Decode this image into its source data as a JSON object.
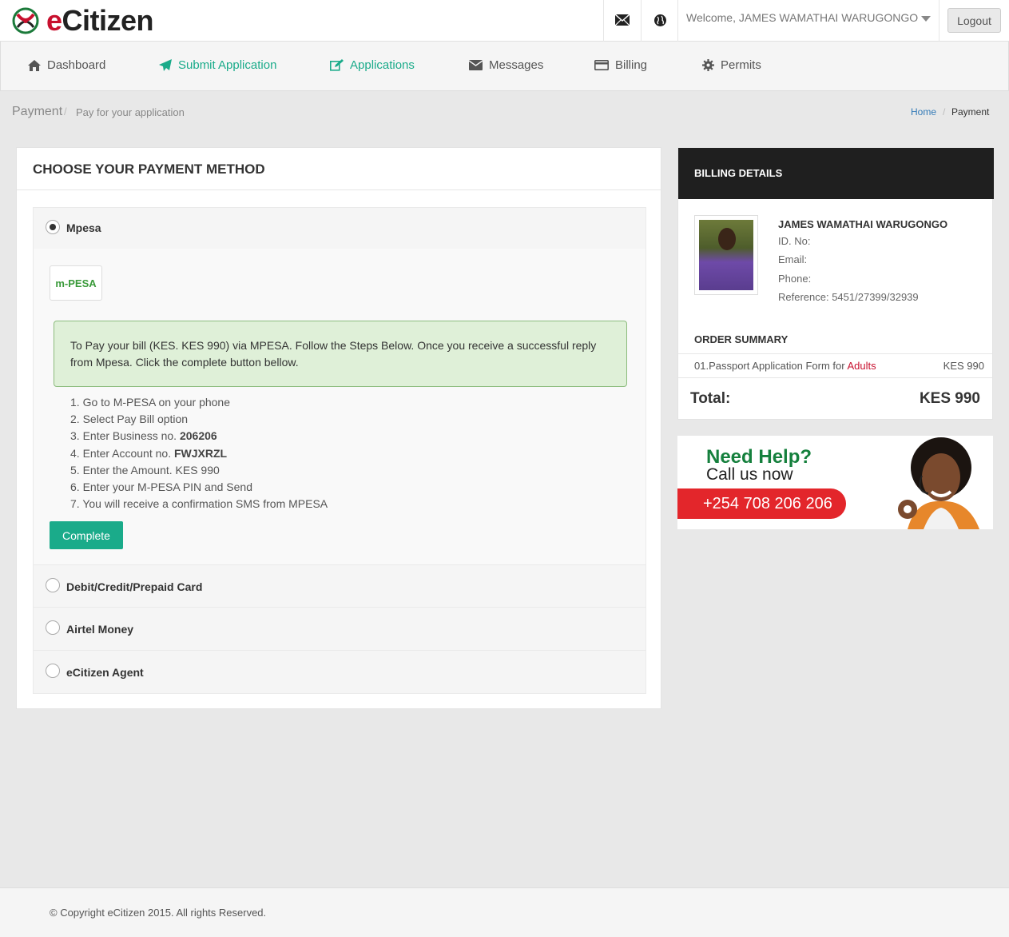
{
  "app": {
    "logo_text": "eCitizen"
  },
  "topbar": {
    "welcome": "Welcome, JAMES WAMATHAI WARUGONGO",
    "logout_label": "Logout"
  },
  "nav": {
    "items": [
      {
        "label": "Dashboard",
        "icon": "home-icon"
      },
      {
        "label": "Submit Application",
        "icon": "paper-plane-icon"
      },
      {
        "label": "Applications",
        "icon": "edit-icon"
      },
      {
        "label": "Messages",
        "icon": "envelope-icon"
      },
      {
        "label": "Billing",
        "icon": "credit-card-icon"
      },
      {
        "label": "Permits",
        "icon": "gear-icon"
      }
    ]
  },
  "page": {
    "title": "Payment",
    "subtitle": "Pay for your application",
    "breadcrumb": {
      "home": "Home",
      "current": "Payment"
    }
  },
  "payment": {
    "heading": "CHOOSE YOUR PAYMENT METHOD",
    "methods": [
      {
        "label": "Mpesa",
        "selected": true
      },
      {
        "label": "Debit/Credit/Prepaid Card",
        "selected": false
      },
      {
        "label": "Airtel Money",
        "selected": false
      },
      {
        "label": "eCitizen Agent",
        "selected": false
      }
    ],
    "mpesa_logo": "m-PESA",
    "alert_text": "To Pay your bill (KES. KES 990) via MPESA. Follow the Steps Below. Once you receive a successful reply from Mpesa. Click the complete button bellow.",
    "steps": [
      {
        "text": "1. Go to M-PESA on your phone"
      },
      {
        "text": "2. Select Pay Bill option"
      },
      {
        "text": "3. Enter Business no. ",
        "bold": "206206"
      },
      {
        "text": "4. Enter Account no. ",
        "bold": "FWJXRZL"
      },
      {
        "text": "5. Enter the Amount. KES 990"
      },
      {
        "text": "6. Enter your M-PESA PIN and Send"
      },
      {
        "text": "7. You will receive a confirmation SMS from MPESA"
      }
    ],
    "complete_label": "Complete"
  },
  "billing": {
    "heading": "BILLING DETAILS",
    "name": "JAMES WAMATHAI WARUGONGO",
    "id_label": "ID. No:",
    "email_label": "Email:",
    "phone_label": "Phone:",
    "reference": "Reference: 5451/27399/32939",
    "order_summary_title": "ORDER SUMMARY",
    "order_item_prefix": "01.Passport Application Form for ",
    "order_item_highlight": "Adults",
    "order_item_amount": "KES 990",
    "total_label": "Total:",
    "total_amount": "KES 990"
  },
  "help": {
    "title": "Need Help?",
    "subtitle": "Call us now",
    "phone": "+254 708 206 206"
  },
  "footer": {
    "copyright": "© Copyright eCitizen 2015. All rights Reserved."
  },
  "colors": {
    "accent": "#1aab8a",
    "brand_red": "#c8102e",
    "dark_header": "#1f1f1f",
    "alert_bg": "#dff0d8"
  }
}
